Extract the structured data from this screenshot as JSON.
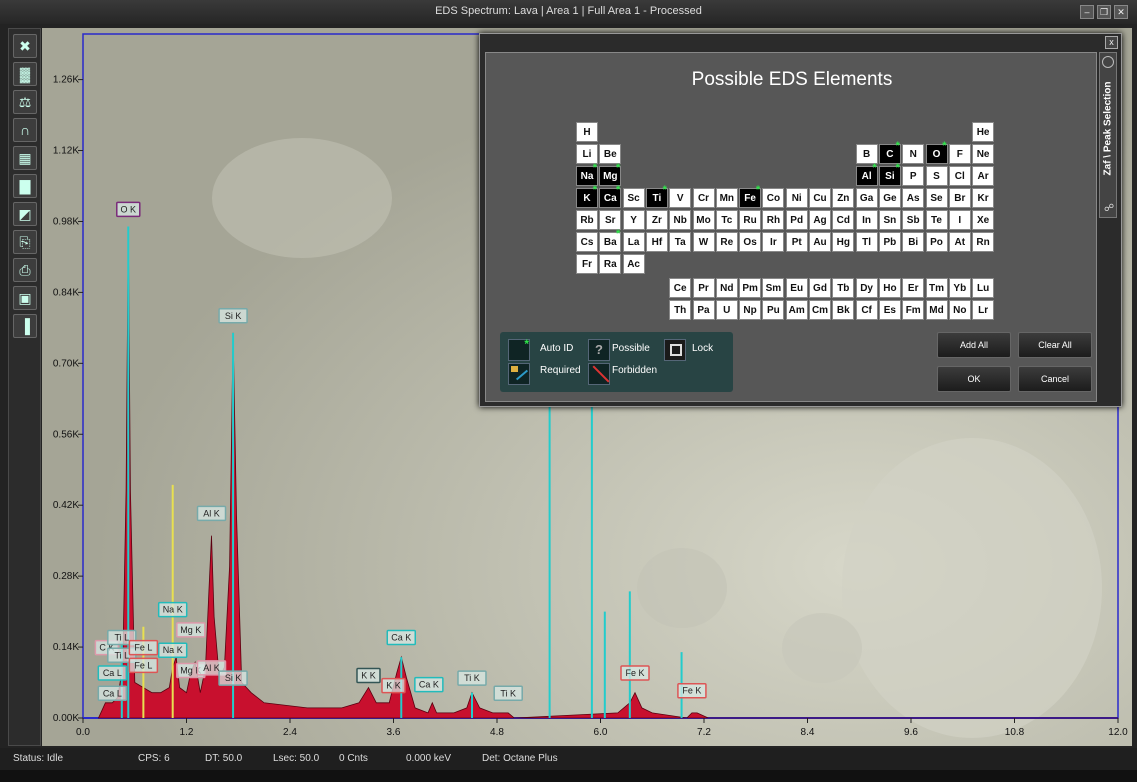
{
  "window": {
    "title": "EDS Spectrum: Lava | Area 1 | Full Area 1 - Processed",
    "minimize_icon": "minimize-icon",
    "restore_icon": "restore-icon",
    "close_icon": "close-icon"
  },
  "toolbar": {
    "icons": [
      "collapse-icon",
      "spectrum-bars-icon",
      "scale-icon",
      "peak-icon",
      "layout-icon",
      "histogram-icon",
      "map-icon",
      "export-icon",
      "print-icon",
      "save-icon",
      "compare-icon"
    ]
  },
  "status": {
    "state": "Status: Idle",
    "cps": "CPS: 6",
    "dt": "DT: 50.0",
    "lsec": "Lsec: 50.0",
    "cnts": "0 Cnts",
    "kev": "0.000 keV",
    "det": "Det: Octane Plus"
  },
  "chart_data": {
    "type": "line",
    "x_ticks": [
      "0.0",
      "1.2",
      "2.4",
      "3.6",
      "4.8",
      "6.0",
      "7.2",
      "8.4",
      "9.6",
      "10.8",
      "12.0"
    ],
    "y_ticks": [
      "0.00K",
      "0.14K",
      "0.28K",
      "0.42K",
      "0.56K",
      "0.70K",
      "0.84K",
      "0.98K",
      "1.12K",
      "1.26K"
    ],
    "xlim": [
      0,
      12
    ],
    "ylim": [
      0,
      1.35
    ],
    "series": [
      {
        "x": [
          0.18,
          0.26,
          0.34,
          0.4,
          0.46,
          0.5,
          0.525,
          0.55,
          0.6,
          0.7,
          0.8,
          0.9,
          1.0,
          1.04,
          1.08,
          1.12,
          1.2,
          1.25,
          1.3,
          1.36,
          1.42,
          1.46,
          1.49,
          1.52,
          1.58,
          1.64,
          1.7,
          1.74,
          1.78,
          1.84,
          1.95,
          2.1,
          2.6,
          3.0,
          3.2,
          3.31,
          3.4,
          3.55,
          3.64,
          3.69,
          3.75,
          3.85,
          4.0,
          4.05,
          4.1,
          4.3,
          4.45,
          4.51,
          4.6,
          4.75,
          4.93,
          5.0,
          6.2,
          6.34,
          6.4,
          6.48,
          6.6,
          7.0,
          7.06,
          7.12,
          7.25,
          8.0,
          12.0
        ],
        "y": [
          0.0,
          0.03,
          0.03,
          0.04,
          0.1,
          0.45,
          0.97,
          0.45,
          0.07,
          0.06,
          0.05,
          0.05,
          0.06,
          0.1,
          0.12,
          0.06,
          0.05,
          0.09,
          0.11,
          0.05,
          0.1,
          0.25,
          0.36,
          0.2,
          0.08,
          0.1,
          0.3,
          0.76,
          0.4,
          0.07,
          0.05,
          0.03,
          0.02,
          0.02,
          0.03,
          0.06,
          0.03,
          0.03,
          0.09,
          0.12,
          0.08,
          0.02,
          0.01,
          0.03,
          0.01,
          0.01,
          0.02,
          0.05,
          0.02,
          0.01,
          0.01,
          0.0,
          0.01,
          0.03,
          0.05,
          0.02,
          0.01,
          0.0,
          0.01,
          0.01,
          0.0,
          0.0,
          0.0
        ]
      }
    ],
    "peaks": [
      {
        "label": "O K",
        "x": 0.525,
        "y": 0.99,
        "color": "#7a2a7a"
      },
      {
        "label": "Si K",
        "x": 1.74,
        "y": 0.78,
        "color": "#7aa"
      },
      {
        "label": "Al K",
        "x": 1.49,
        "y": 0.39,
        "color": "#7aa"
      },
      {
        "label": "Na K",
        "x": 1.04,
        "y": 0.2,
        "color": "#2bb"
      },
      {
        "label": "Mg K",
        "x": 1.25,
        "y": 0.16,
        "color": "#d9a"
      },
      {
        "label": "Na K",
        "x": 1.04,
        "y": 0.12,
        "color": "#2bb"
      },
      {
        "label": "Mg K",
        "x": 1.25,
        "y": 0.08,
        "color": "#d9a"
      },
      {
        "label": "Al K",
        "x": 1.49,
        "y": 0.085,
        "color": "#d9a"
      },
      {
        "label": "Si K",
        "x": 1.74,
        "y": 0.065,
        "color": "#7aa"
      },
      {
        "label": "C K",
        "x": 0.277,
        "y": 0.125,
        "color": "#d9a"
      },
      {
        "label": "Ti L",
        "x": 0.45,
        "y": 0.145,
        "color": "#7aa"
      },
      {
        "label": "Ti L",
        "x": 0.45,
        "y": 0.11,
        "color": "#7aa"
      },
      {
        "label": "Ca L",
        "x": 0.34,
        "y": 0.075,
        "color": "#2bb"
      },
      {
        "label": "Ca L",
        "x": 0.34,
        "y": 0.035,
        "color": "#7aa"
      },
      {
        "label": "Fe L",
        "x": 0.7,
        "y": 0.125,
        "color": "#d55"
      },
      {
        "label": "Fe L",
        "x": 0.7,
        "y": 0.09,
        "color": "#d55"
      },
      {
        "label": "K K",
        "x": 3.31,
        "y": 0.07,
        "color": "#355"
      },
      {
        "label": "K K",
        "x": 3.6,
        "y": 0.05,
        "color": "#d55"
      },
      {
        "label": "Ca K",
        "x": 3.69,
        "y": 0.145,
        "color": "#2bb"
      },
      {
        "label": "Ca K",
        "x": 4.01,
        "y": 0.052,
        "color": "#2bb"
      },
      {
        "label": "Ti K",
        "x": 4.51,
        "y": 0.065,
        "color": "#7aa"
      },
      {
        "label": "Ti K",
        "x": 4.93,
        "y": 0.035,
        "color": "#7aa"
      },
      {
        "label": "Fe K",
        "x": 6.4,
        "y": 0.075,
        "color": "#d55"
      },
      {
        "label": "Fe K",
        "x": 7.06,
        "y": 0.04,
        "color": "#d55"
      }
    ],
    "markers": [
      {
        "x": 0.525,
        "y": 0.97,
        "color": "#2cc"
      },
      {
        "x": 1.74,
        "y": 0.76,
        "color": "#2cc"
      },
      {
        "x": 1.04,
        "y": 0.46,
        "color": "#e8e050"
      },
      {
        "x": 0.7,
        "y": 0.18,
        "color": "#e8e050"
      },
      {
        "x": 0.45,
        "y": 0.15,
        "color": "#2cc"
      },
      {
        "x": 5.41,
        "y": 0.95,
        "color": "#2cc"
      },
      {
        "x": 5.9,
        "y": 0.95,
        "color": "#2cc"
      },
      {
        "x": 6.05,
        "y": 0.21,
        "color": "#2cc"
      },
      {
        "x": 6.34,
        "y": 0.25,
        "color": "#2cc"
      },
      {
        "x": 6.94,
        "y": 0.13,
        "color": "#2cc"
      },
      {
        "x": 3.69,
        "y": 0.12,
        "color": "#2cc"
      },
      {
        "x": 4.51,
        "y": 0.05,
        "color": "#2cc"
      }
    ]
  },
  "dialog": {
    "title": "Possible EDS Elements",
    "close_label": "x",
    "side_tab": "Zaf \\ Peak Selection",
    "side_tab_icon": "pin-icon",
    "main_rows": [
      [
        {
          "s": "H",
          "c": 0
        },
        {
          "s": "He",
          "c": 17
        }
      ],
      [
        {
          "s": "Li",
          "c": 0
        },
        {
          "s": "Be",
          "c": 1
        },
        {
          "s": "B",
          "c": 12
        },
        {
          "s": "C",
          "c": 13,
          "auto": true
        },
        {
          "s": "N",
          "c": 14
        },
        {
          "s": "O",
          "c": 15,
          "auto": true
        },
        {
          "s": "F",
          "c": 16
        },
        {
          "s": "Ne",
          "c": 17
        }
      ],
      [
        {
          "s": "Na",
          "c": 0,
          "auto": true
        },
        {
          "s": "Mg",
          "c": 1,
          "auto": true
        },
        {
          "s": "Al",
          "c": 12,
          "auto": true
        },
        {
          "s": "Si",
          "c": 13,
          "auto": true
        },
        {
          "s": "P",
          "c": 14
        },
        {
          "s": "S",
          "c": 15
        },
        {
          "s": "Cl",
          "c": 16
        },
        {
          "s": "Ar",
          "c": 17
        }
      ],
      [
        {
          "s": "K",
          "c": 0,
          "auto": true
        },
        {
          "s": "Ca",
          "c": 1,
          "auto": true
        },
        {
          "s": "Sc",
          "c": 2
        },
        {
          "s": "Ti",
          "c": 3,
          "auto": true
        },
        {
          "s": "V",
          "c": 4
        },
        {
          "s": "Cr",
          "c": 5
        },
        {
          "s": "Mn",
          "c": 6
        },
        {
          "s": "Fe",
          "c": 7,
          "auto": true
        },
        {
          "s": "Co",
          "c": 8
        },
        {
          "s": "Ni",
          "c": 9
        },
        {
          "s": "Cu",
          "c": 10
        },
        {
          "s": "Zn",
          "c": 11
        },
        {
          "s": "Ga",
          "c": 12
        },
        {
          "s": "Ge",
          "c": 13
        },
        {
          "s": "As",
          "c": 14
        },
        {
          "s": "Se",
          "c": 15
        },
        {
          "s": "Br",
          "c": 16
        },
        {
          "s": "Kr",
          "c": 17
        }
      ],
      [
        {
          "s": "Rb",
          "c": 0
        },
        {
          "s": "Sr",
          "c": 1
        },
        {
          "s": "Y",
          "c": 2
        },
        {
          "s": "Zr",
          "c": 3
        },
        {
          "s": "Nb",
          "c": 4
        },
        {
          "s": "Mo",
          "c": 5
        },
        {
          "s": "Tc",
          "c": 6
        },
        {
          "s": "Ru",
          "c": 7
        },
        {
          "s": "Rh",
          "c": 8
        },
        {
          "s": "Pd",
          "c": 9
        },
        {
          "s": "Ag",
          "c": 10
        },
        {
          "s": "Cd",
          "c": 11
        },
        {
          "s": "In",
          "c": 12
        },
        {
          "s": "Sn",
          "c": 13
        },
        {
          "s": "Sb",
          "c": 14
        },
        {
          "s": "Te",
          "c": 15
        },
        {
          "s": "I",
          "c": 16
        },
        {
          "s": "Xe",
          "c": 17
        }
      ],
      [
        {
          "s": "Cs",
          "c": 0
        },
        {
          "s": "Ba",
          "c": 1,
          "possible": true
        },
        {
          "s": "La",
          "c": 2
        },
        {
          "s": "Hf",
          "c": 3
        },
        {
          "s": "Ta",
          "c": 4
        },
        {
          "s": "W",
          "c": 5
        },
        {
          "s": "Re",
          "c": 6
        },
        {
          "s": "Os",
          "c": 7
        },
        {
          "s": "Ir",
          "c": 8
        },
        {
          "s": "Pt",
          "c": 9
        },
        {
          "s": "Au",
          "c": 10
        },
        {
          "s": "Hg",
          "c": 11
        },
        {
          "s": "Tl",
          "c": 12
        },
        {
          "s": "Pb",
          "c": 13
        },
        {
          "s": "Bi",
          "c": 14
        },
        {
          "s": "Po",
          "c": 15
        },
        {
          "s": "At",
          "c": 16
        },
        {
          "s": "Rn",
          "c": 17
        }
      ],
      [
        {
          "s": "Fr",
          "c": 0
        },
        {
          "s": "Ra",
          "c": 1
        },
        {
          "s": "Ac",
          "c": 2
        }
      ]
    ],
    "lanthanides": [
      "Ce",
      "Pr",
      "Nd",
      "Pm",
      "Sm",
      "Eu",
      "Gd",
      "Tb",
      "Dy",
      "Ho",
      "Er",
      "Tm",
      "Yb",
      "Lu"
    ],
    "actinides": [
      "Th",
      "Pa",
      "U",
      "Np",
      "Pu",
      "Am",
      "Cm",
      "Bk",
      "Cf",
      "Es",
      "Fm",
      "Md",
      "No",
      "Lr"
    ],
    "legend": {
      "auto_id": "Auto ID",
      "possible": "Possible",
      "lock": "Lock",
      "required": "Required",
      "forbidden": "Forbidden",
      "auto_id_icon": "auto-id-star-icon",
      "possible_icon": "possible-question-icon",
      "lock_icon": "lock-grid-icon",
      "required_icon": "required-lock-icon",
      "forbidden_icon": "forbidden-slash-icon"
    },
    "buttons": {
      "add_all": "Add All",
      "clear_all": "Clear All",
      "ok": "OK",
      "cancel": "Cancel"
    },
    "colors": {
      "auto_star": "#2ee64a",
      "legend_bg": "#284444"
    }
  }
}
